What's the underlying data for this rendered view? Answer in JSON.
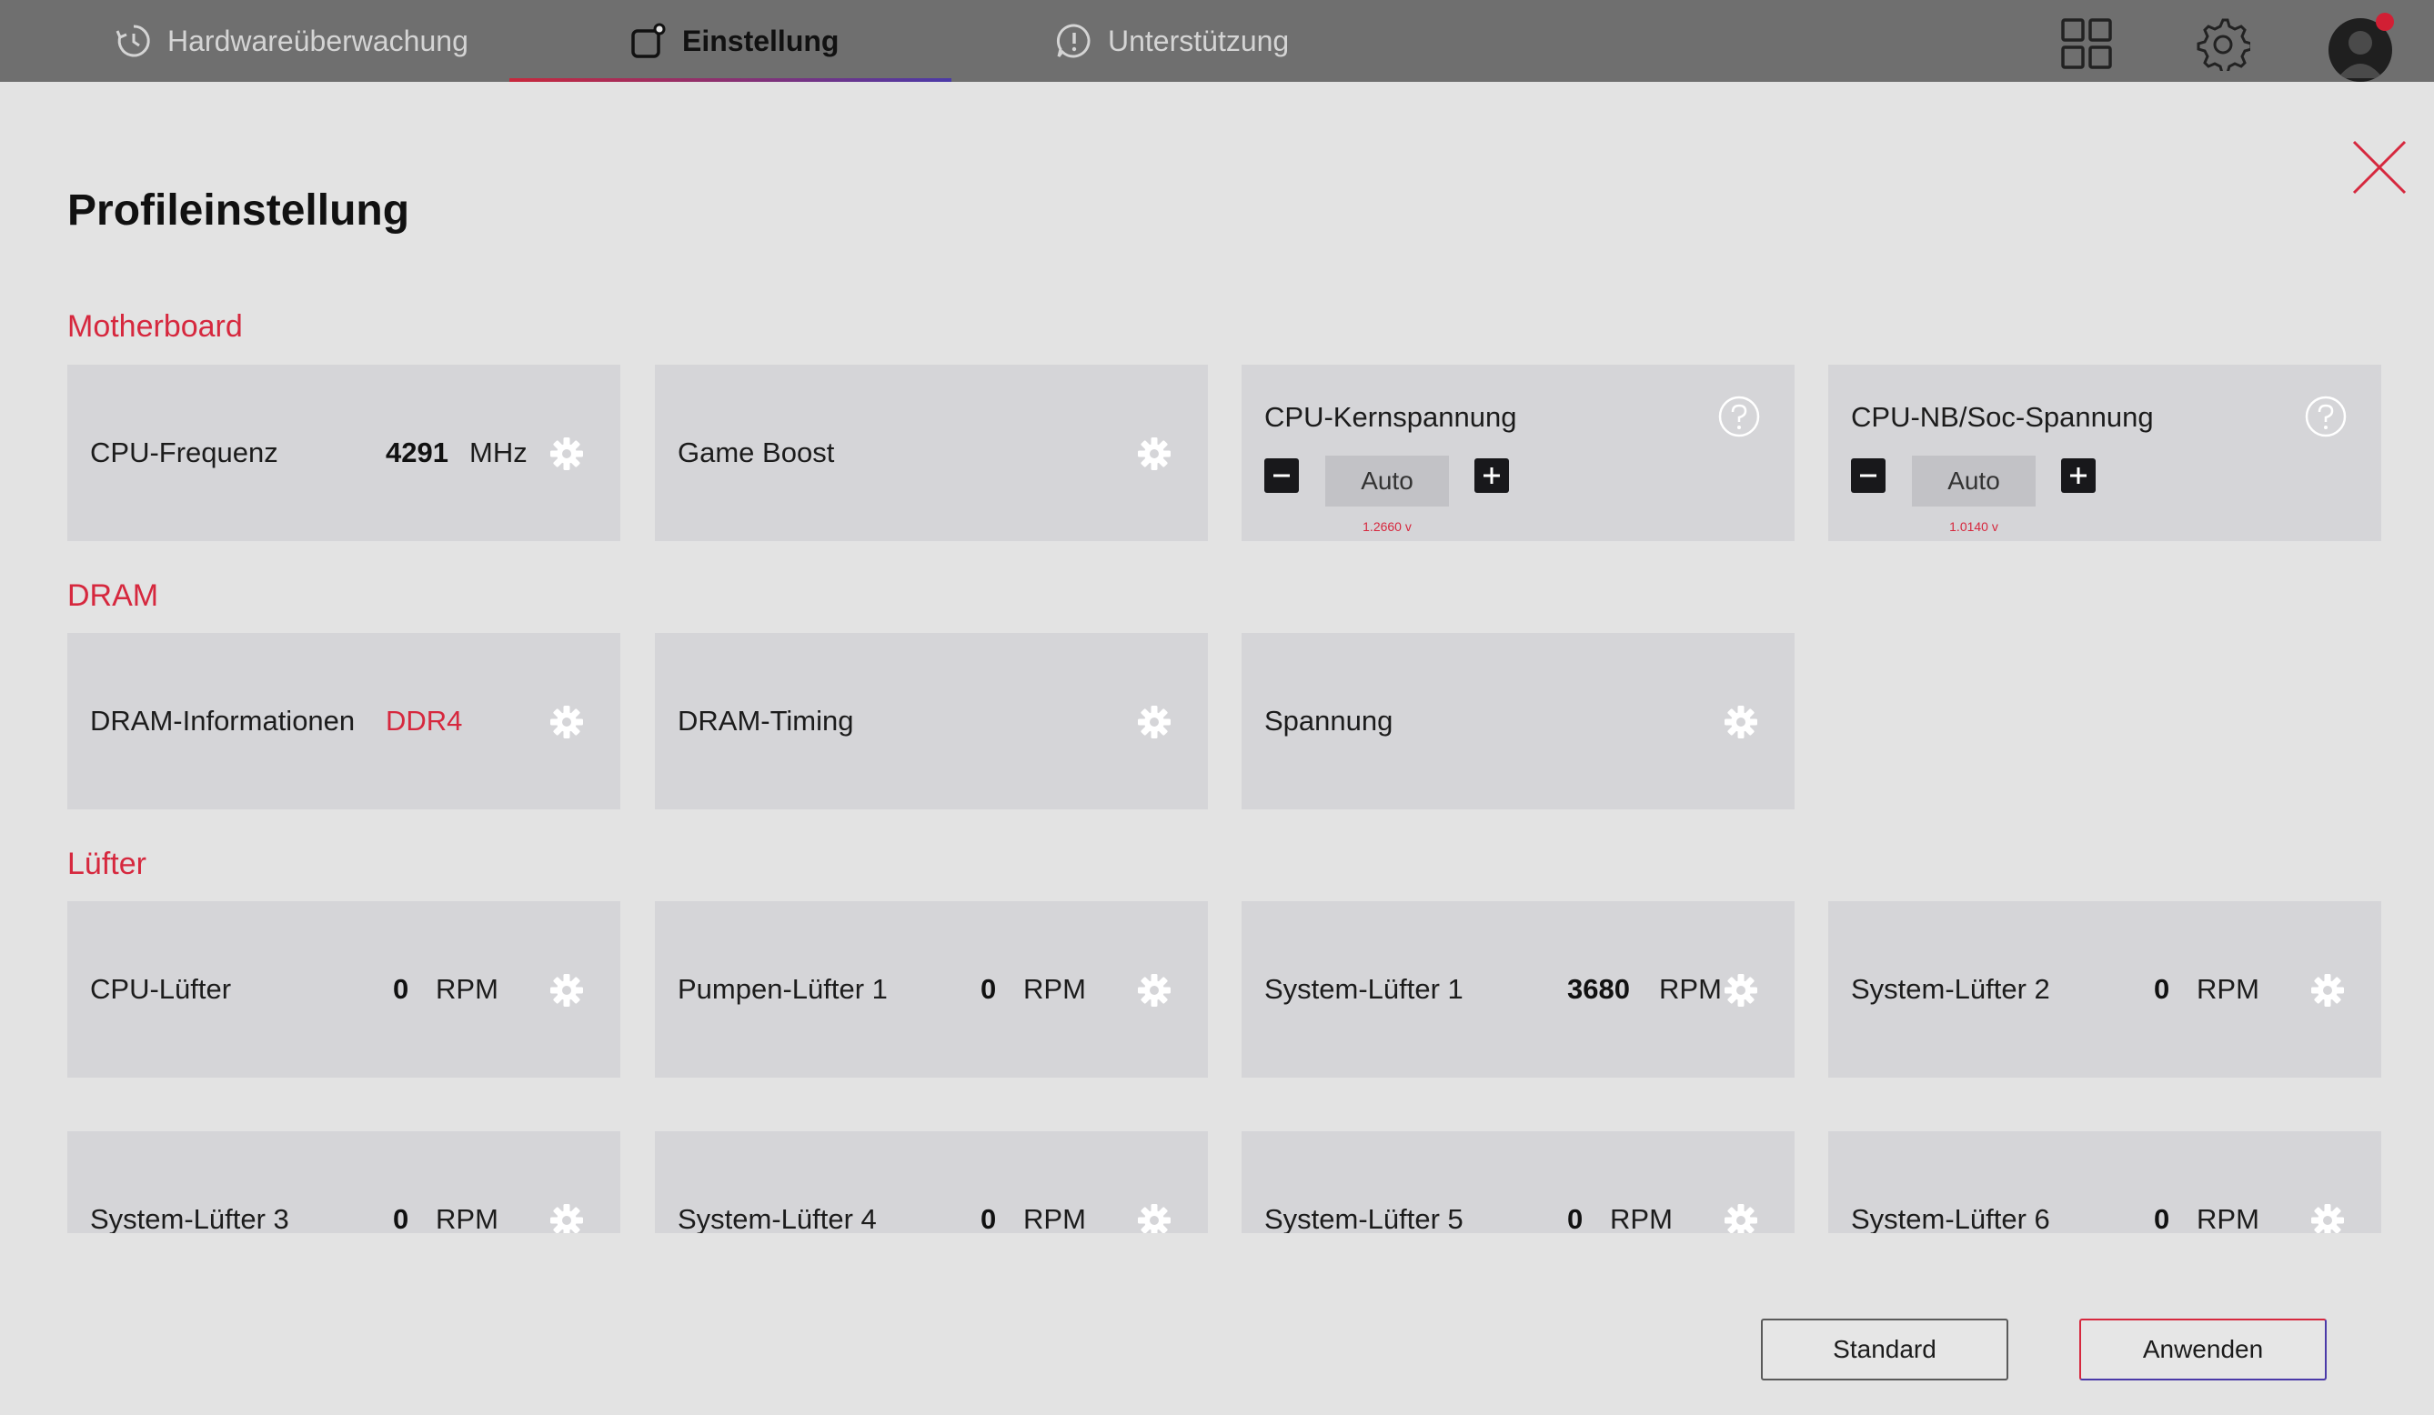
{
  "tabs": [
    {
      "label": "Hardwareüberwachung",
      "icon": "history-icon"
    },
    {
      "label": "Einstellung",
      "icon": "settings-export-icon"
    },
    {
      "label": "Unterstützung",
      "icon": "support-chat-icon"
    }
  ],
  "page_title": "Profileinstellung",
  "sections": {
    "motherboard": "Motherboard",
    "dram": "DRAM",
    "fans": "Lüfter"
  },
  "motherboard": {
    "cpu_freq": {
      "label": "CPU-Frequenz",
      "value": "4291",
      "unit": "MHz"
    },
    "game_boost": {
      "label": "Game Boost"
    },
    "core_voltage": {
      "label": "CPU-Kernspannung",
      "value": "Auto",
      "reading": "1.2660 v"
    },
    "nb_voltage": {
      "label": "CPU-NB/Soc-Spannung",
      "value": "Auto",
      "reading": "1.0140 v"
    }
  },
  "dram": {
    "info": {
      "label": "DRAM-Informationen",
      "value": "DDR4"
    },
    "timing": {
      "label": "DRAM-Timing"
    },
    "voltage": {
      "label": "Spannung"
    }
  },
  "fans": [
    {
      "label": "CPU-Lüfter",
      "value": "0",
      "unit": "RPM"
    },
    {
      "label": "Pumpen-Lüfter 1",
      "value": "0",
      "unit": "RPM"
    },
    {
      "label": "System-Lüfter 1",
      "value": "3680",
      "unit": "RPM"
    },
    {
      "label": "System-Lüfter 2",
      "value": "0",
      "unit": "RPM"
    },
    {
      "label": "System-Lüfter 3",
      "value": "0",
      "unit": "RPM"
    },
    {
      "label": "System-Lüfter 4",
      "value": "0",
      "unit": "RPM"
    },
    {
      "label": "System-Lüfter 5",
      "value": "0",
      "unit": "RPM"
    },
    {
      "label": "System-Lüfter 6",
      "value": "0",
      "unit": "RPM"
    }
  ],
  "buttons": {
    "standard": "Standard",
    "apply": "Anwenden"
  },
  "colors": {
    "accent_red": "#d6283e",
    "accent_blue": "#4b3aa8",
    "topbar": "#6f6f6f",
    "card": "#d5d5d8"
  }
}
